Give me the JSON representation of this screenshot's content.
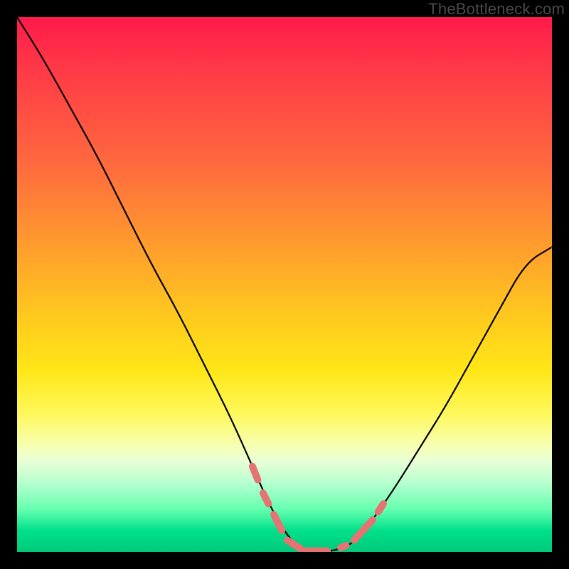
{
  "watermark": "TheBottleneck.com",
  "chart_data": {
    "type": "line",
    "title": "",
    "xlabel": "",
    "ylabel": "",
    "xlim": [
      0,
      100
    ],
    "ylim": [
      0,
      100
    ],
    "series": [
      {
        "name": "bottleneck-curve",
        "x": [
          0,
          5,
          10,
          15,
          20,
          25,
          30,
          35,
          40,
          44,
          48,
          52,
          55,
          58,
          62,
          65,
          70,
          75,
          80,
          85,
          90,
          95,
          100
        ],
        "y": [
          100,
          92,
          83,
          74,
          64,
          54,
          45,
          35,
          25,
          16,
          7,
          1,
          0,
          0,
          1,
          4,
          11,
          19,
          27,
          36,
          45,
          54,
          57
        ]
      }
    ],
    "markers": {
      "name": "highlight-dashes",
      "segments": [
        {
          "x1": 44.0,
          "y1": 16.0,
          "x2": 45.0,
          "y2": 13.5
        },
        {
          "x1": 46.0,
          "y1": 11.0,
          "x2": 47.0,
          "y2": 9.0
        },
        {
          "x1": 48.0,
          "y1": 7.0,
          "x2": 49.5,
          "y2": 4.0
        },
        {
          "x1": 50.5,
          "y1": 2.2,
          "x2": 53.0,
          "y2": 0.6
        },
        {
          "x1": 54.0,
          "y1": 0.2,
          "x2": 58.0,
          "y2": 0.2
        },
        {
          "x1": 60.5,
          "y1": 0.8,
          "x2": 61.5,
          "y2": 1.2
        },
        {
          "x1": 63.0,
          "y1": 2.2,
          "x2": 66.5,
          "y2": 6.0
        },
        {
          "x1": 67.5,
          "y1": 7.5,
          "x2": 68.5,
          "y2": 9.0
        }
      ]
    },
    "gradient_stops": [
      {
        "pos": 0,
        "color": "#ff1a4b"
      },
      {
        "pos": 28,
        "color": "#ff6b3e"
      },
      {
        "pos": 55,
        "color": "#ffc61f"
      },
      {
        "pos": 80,
        "color": "#f7ffb0"
      },
      {
        "pos": 100,
        "color": "#00c97a"
      }
    ]
  }
}
